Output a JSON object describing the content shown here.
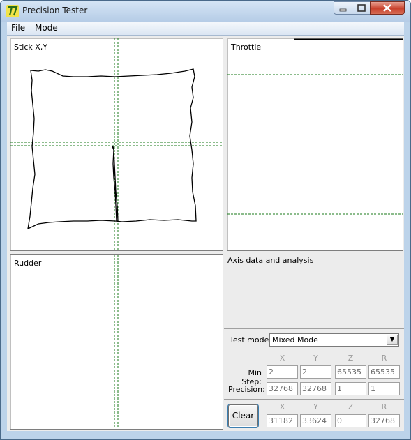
{
  "window": {
    "title": "Precision Tester"
  },
  "menu": {
    "items": [
      "File",
      "Mode"
    ]
  },
  "panes": {
    "stick": "Stick X,Y",
    "throttle": "Throttle",
    "rudder": "Rudder"
  },
  "analysis": {
    "heading": "Axis data and analysis",
    "test_mode_label": "Test mode:",
    "test_mode_value": "Mixed Mode",
    "columns": [
      "X",
      "Y",
      "Z",
      "R"
    ],
    "min_step_label": "Min Step:",
    "min_step": [
      "2",
      "2",
      "65535",
      "65535"
    ],
    "precision_label": "Precision:",
    "precision": [
      "32768",
      "32768",
      "1",
      "1"
    ],
    "clear_label": "Clear",
    "current": [
      "31182",
      "33624",
      "0",
      "32768"
    ]
  },
  "colors": {
    "crosshair": "#1a7a1a",
    "trace": "#000000"
  }
}
